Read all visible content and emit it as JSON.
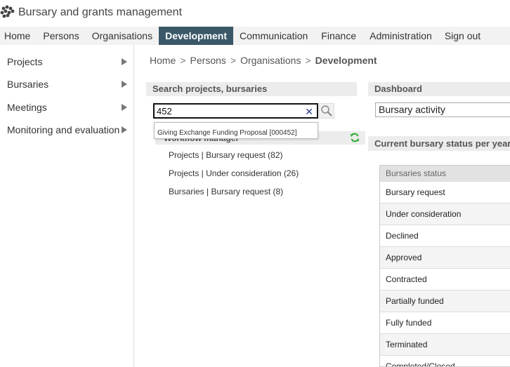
{
  "app": {
    "title": "Bursary and grants management"
  },
  "topnav": {
    "items": [
      {
        "label": "Home"
      },
      {
        "label": "Persons"
      },
      {
        "label": "Organisations"
      },
      {
        "label": "Development",
        "active": true
      },
      {
        "label": "Communication"
      },
      {
        "label": "Finance"
      },
      {
        "label": "Administration"
      },
      {
        "label": "Sign out"
      }
    ]
  },
  "sidebar": {
    "items": [
      {
        "label": "Projects"
      },
      {
        "label": "Bursaries"
      },
      {
        "label": "Meetings"
      },
      {
        "label": "Monitoring and evaluation"
      }
    ]
  },
  "breadcrumb": {
    "items": [
      "Home",
      "Persons",
      "Organisations"
    ],
    "current": "Development",
    "separator": ">"
  },
  "search": {
    "header": "Search projects, bursaries",
    "value": "452",
    "clear": "✕",
    "suggestion": "Giving Exchange Funding Proposal [000452]"
  },
  "workflow": {
    "title": "Workflow manager",
    "links": [
      "Projects | Bursary request (82)",
      "Projects | Under consideration (26)",
      "Bursaries | Bursary request (8)"
    ]
  },
  "dashboard": {
    "header": "Dashboard",
    "selected": "Bursary activity",
    "status_header": "Current bursary status per year",
    "table_header": "Bursaries status",
    "statuses": [
      "Bursary request",
      "Under consideration",
      "Declined",
      "Approved",
      "Contracted",
      "Partially funded",
      "Fully funded",
      "Terminated",
      "Completed/Closed"
    ]
  },
  "colors": {
    "nav_active": "#3a5868",
    "refresh_icon": "#2eaa2e",
    "clear_icon": "#2a3f8a"
  }
}
